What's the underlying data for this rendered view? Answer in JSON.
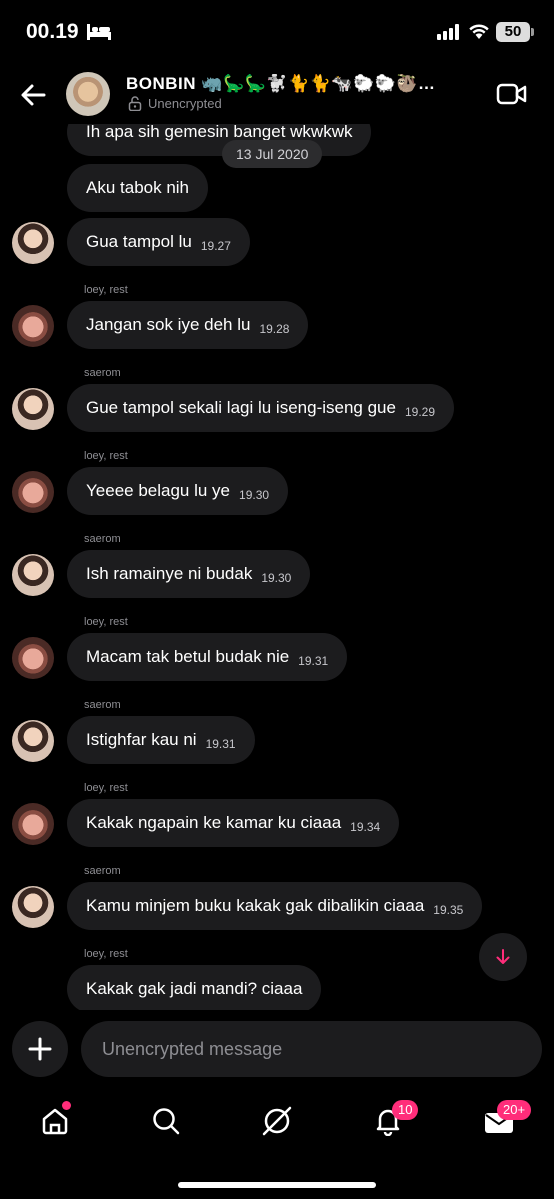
{
  "status_bar": {
    "time": "00.19",
    "battery": "50"
  },
  "header": {
    "title": "BONBIN 🦏🦕🦕🐩🐈🐈🐄🐑🐑🦥…",
    "subtitle": "Unencrypted"
  },
  "chat": {
    "date_separator": "13 Jul 2020",
    "messages": [
      {
        "text": "Ih apa sih gemesin banget wkwkwk",
        "time": ""
      },
      {
        "text": "Aku tabok nih",
        "time": ""
      },
      {
        "text": "Gua tampol lu",
        "time": "19.27"
      },
      {
        "sender": "loey, rest",
        "text": "Jangan sok iye deh lu",
        "time": "19.28"
      },
      {
        "sender": "saerom",
        "text": "Gue tampol sekali lagi lu iseng-iseng gue",
        "time": "19.29"
      },
      {
        "sender": "loey, rest",
        "text": "Yeeee belagu lu ye",
        "time": "19.30"
      },
      {
        "sender": "saerom",
        "text": "Ish ramainye ni budak",
        "time": "19.30"
      },
      {
        "sender": "loey, rest",
        "text": "Macam tak betul budak nie",
        "time": "19.31"
      },
      {
        "sender": "saerom",
        "text": "Istighfar kau ni",
        "time": "19.31"
      },
      {
        "sender": "loey, rest",
        "text": "Kakak ngapain ke kamar ku ciaaa",
        "time": "19.34"
      },
      {
        "sender": "saerom",
        "text": "Kamu minjem buku kakak gak dibalikin ciaaa",
        "time": "19.35"
      },
      {
        "sender": "loey, rest",
        "text": "Kakak gak jadi mandi? ciaaa",
        "time": ""
      }
    ]
  },
  "composer": {
    "placeholder": "Unencrypted message"
  },
  "nav": {
    "notifications_badge": "10",
    "inbox_badge": "20+"
  },
  "colors": {
    "accent": "#ff2d7a",
    "bubble": "#1c1c1e",
    "background": "#000000"
  }
}
